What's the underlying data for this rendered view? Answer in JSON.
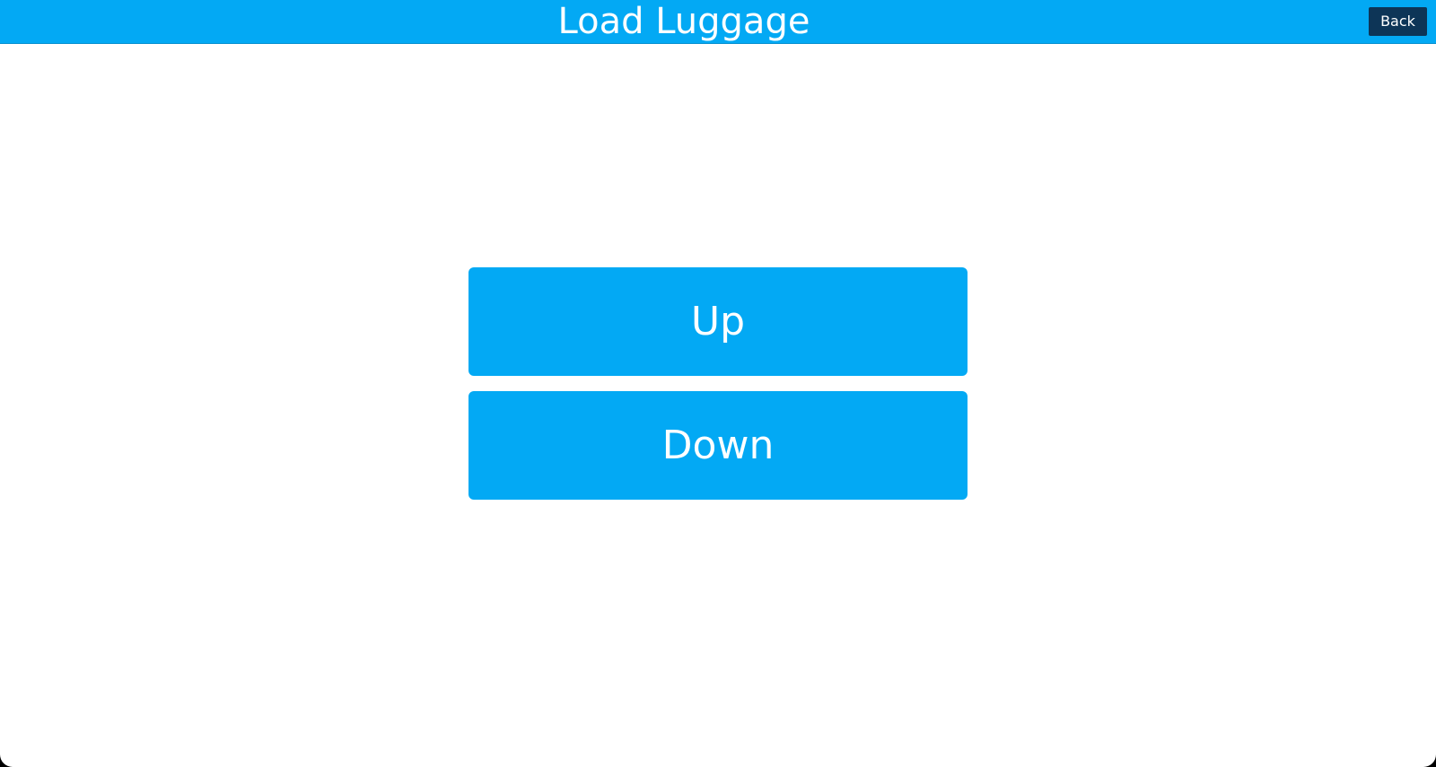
{
  "header": {
    "title": "Load Luggage",
    "back_label": "Back"
  },
  "controls": {
    "up_label": "Up",
    "down_label": "Down"
  },
  "colors": {
    "accent": "#03a9f4",
    "back_button": "#0d3557",
    "background": "#ffffff"
  }
}
